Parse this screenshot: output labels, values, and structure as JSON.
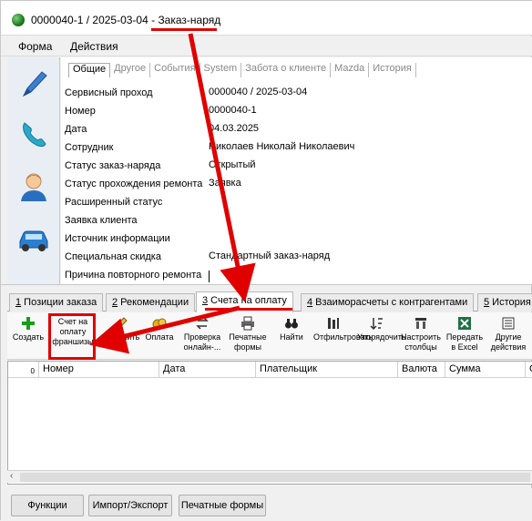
{
  "title": {
    "number": "0000040-1 / 2025-03-04 - ",
    "kind": "Заказ-наряд"
  },
  "menu": {
    "form": "Форма",
    "actions": "Действия"
  },
  "props_tabs": [
    "Общие",
    "Другое",
    "События",
    "System",
    "Забота о клиенте",
    "Mazda",
    "История"
  ],
  "props": [
    {
      "label": "Сервисный проход",
      "value": "0000040 / 2025-03-04"
    },
    {
      "label": "Номер",
      "value": "0000040-1"
    },
    {
      "label": "Дата",
      "value": "04.03.2025"
    },
    {
      "label": "Сотрудник",
      "value": "Николаев Николай Николаевич"
    },
    {
      "label": "Статус заказ-наряда",
      "value": "Открытый"
    },
    {
      "label": "Статус прохождения ремонта",
      "value": "Заявка"
    },
    {
      "label": "Расширенный статус",
      "value": ""
    },
    {
      "label": "Заявка клиента",
      "value": ""
    },
    {
      "label": "Источник информации",
      "value": ""
    },
    {
      "label": "Специальная скидка",
      "value": "Стандартный заказ-наряд"
    },
    {
      "label": "Причина повторного ремонта",
      "value": ""
    }
  ],
  "doc_tabs": [
    {
      "num": "1",
      "label": " Позиции заказа"
    },
    {
      "num": "2",
      "label": " Рекомендации"
    },
    {
      "num": "3",
      "label": " Счета на оплату"
    },
    {
      "num": "4",
      "label": " Взаиморасчеты с контрагентами"
    },
    {
      "num": "5",
      "label": " История з"
    }
  ],
  "toolbar": {
    "create": "Создать",
    "franchise": "Счет на оплату франшизы",
    "edit": "Изменить",
    "pay": "Оплата",
    "check_online": "Проверка онлайн-...",
    "print_forms": "Печатные формы",
    "find": "Найти",
    "filter": "Отфильтровать",
    "sort": "Упорядочить",
    "columns": "Настроить столбцы",
    "excel": "Передать в Excel",
    "other": "Другие действия"
  },
  "grid": {
    "row_indicator": "0",
    "columns": [
      "Номер",
      "Дата",
      "Плательщик",
      "Валюта",
      "Сумма",
      "С"
    ]
  },
  "hscroll": {
    "left_arrow": "‹"
  },
  "bottom": {
    "functions": "Функции",
    "import_export": "Импорт/Экспорт",
    "print_forms": "Печатные формы"
  },
  "colors": {
    "highlight": "#e00000",
    "excel": "#1e7145",
    "plus": "#1a9e1a"
  }
}
